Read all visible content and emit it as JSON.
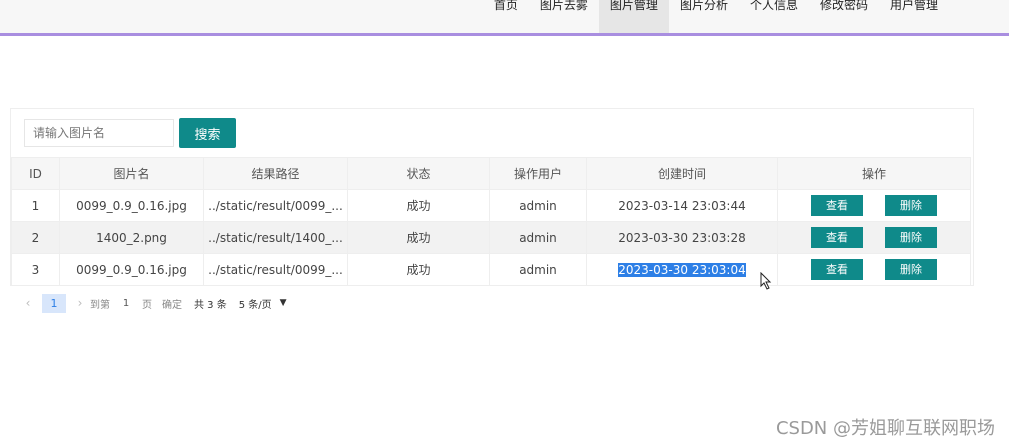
{
  "nav": {
    "items": [
      {
        "label": "首页"
      },
      {
        "label": "图片去雾"
      },
      {
        "label": "图片管理"
      },
      {
        "label": "图片分析"
      },
      {
        "label": "个人信息"
      },
      {
        "label": "修改密码"
      },
      {
        "label": "用户管理"
      }
    ],
    "active": "图片管理",
    "accent": "#a98ee0"
  },
  "search": {
    "placeholder": "请输入图片名",
    "button_label": "搜索",
    "value": ""
  },
  "table": {
    "headers": [
      "ID",
      "图片名",
      "结果路径",
      "状态",
      "操作用户",
      "创建时间",
      "操作"
    ],
    "rows": [
      {
        "id": "1",
        "name": "0099_0.9_0.16.jpg",
        "path": "../static/result/0099_...",
        "status": "成功",
        "user": "admin",
        "time": "2023-03-14 23:03:44",
        "view": "查看",
        "delete": "删除"
      },
      {
        "id": "2",
        "name": "1400_2.png",
        "path": "../static/result/1400_...",
        "status": "成功",
        "user": "admin",
        "time": "2023-03-30 23:03:28",
        "view": "查看",
        "delete": "删除"
      },
      {
        "id": "3",
        "name": "0099_0.9_0.16.jpg",
        "path": "../static/result/0099_...",
        "status": "成功",
        "user": "admin",
        "time": "2023-03-30 23:03:04",
        "view": "查看",
        "delete": "删除"
      }
    ],
    "button_color": "#0f8a8a"
  },
  "pagination": {
    "prev": "‹",
    "current_page": "1",
    "next": "›",
    "goto_label": "到第",
    "goto_value": "1",
    "page_unit": "页",
    "confirm": "确定",
    "total": "共 3 条",
    "page_size": "5 条/页"
  },
  "watermark": "CSDN @芳姐聊互联网职场"
}
